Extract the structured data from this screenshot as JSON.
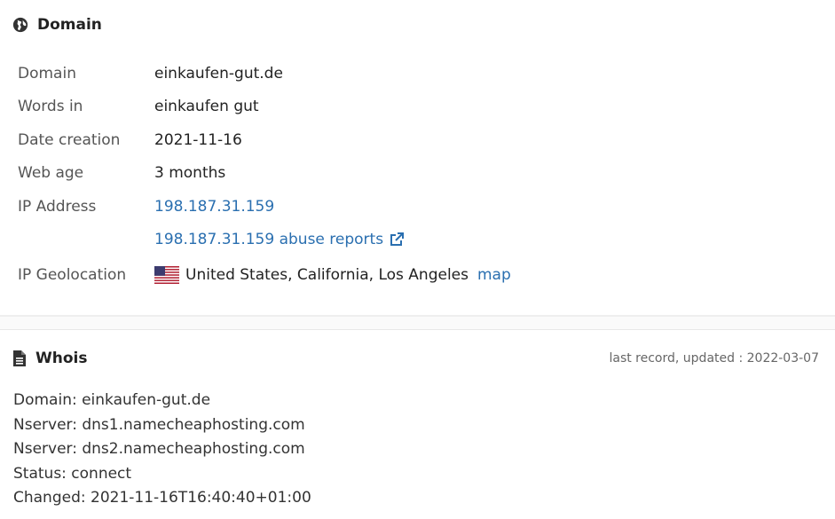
{
  "domain_section": {
    "title": "Domain",
    "icon": "globe-icon",
    "rows": {
      "domain": {
        "label": "Domain",
        "value": "einkaufen-gut.de"
      },
      "words": {
        "label": "Words in",
        "value": "einkaufen gut"
      },
      "date": {
        "label": "Date creation",
        "value": "2021-11-16"
      },
      "age": {
        "label": "Web age",
        "value": "3 months"
      },
      "ip": {
        "label": "IP Address",
        "value": "198.187.31.159"
      },
      "abuse": {
        "value": "198.187.31.159 abuse reports"
      },
      "geo": {
        "label": "IP Geolocation",
        "value": "United States, California, Los Angeles",
        "map_label": "map"
      }
    }
  },
  "whois_section": {
    "title": "Whois",
    "icon": "document-icon",
    "updated": "last record, updated : 2022-03-07",
    "lines": [
      "Domain: einkaufen-gut.de",
      "Nserver: dns1.namecheaphosting.com",
      "Nserver: dns2.namecheaphosting.com",
      "Status: connect",
      "Changed: 2021-11-16T16:40:40+01:00"
    ]
  },
  "colors": {
    "link": "#2a6fb0",
    "text": "#333333",
    "label": "#555555"
  }
}
